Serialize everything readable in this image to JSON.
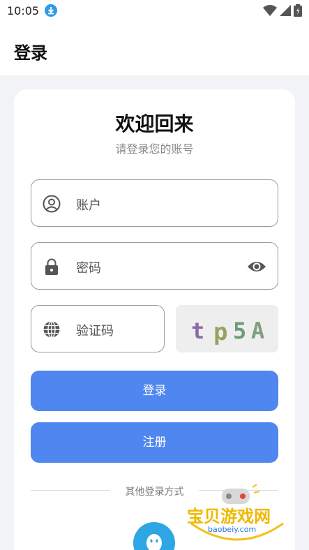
{
  "status_bar": {
    "time": "10:05",
    "icons": [
      "download-icon",
      "wifi-icon",
      "signal-icon",
      "battery-icon"
    ]
  },
  "app_bar": {
    "title": "登录"
  },
  "login": {
    "welcome": "欢迎回来",
    "subtitle": "请登录您的账号",
    "account_placeholder": "账户",
    "password_placeholder": "密码",
    "captcha_placeholder": "验证码",
    "captcha_image_text": "tp5A",
    "login_button": "登录",
    "register_button": "注册",
    "other_methods": "其他登录方式"
  },
  "watermark": {
    "brand": "宝贝游戏网",
    "url": "baobeiy.com"
  },
  "colors": {
    "accent": "#4f86f0",
    "qq": "#2ea6e3",
    "background": "#f2f3f7"
  }
}
